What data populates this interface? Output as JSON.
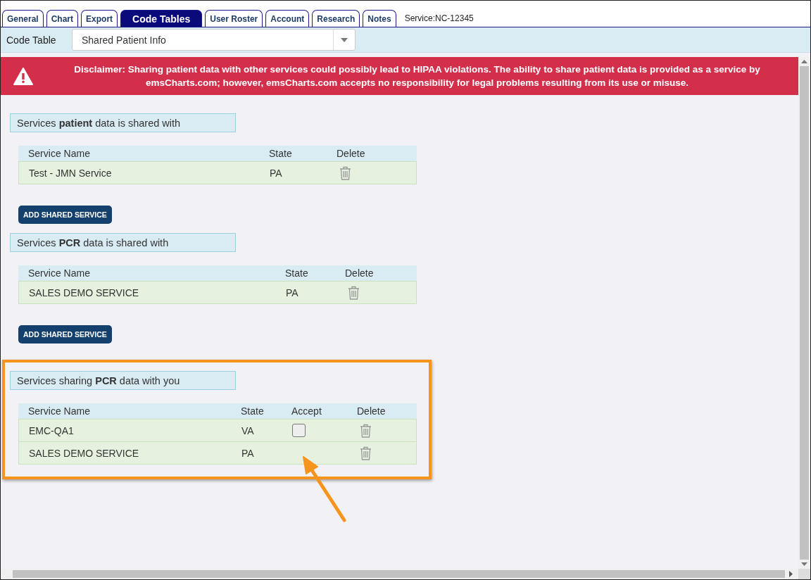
{
  "tabs": [
    {
      "label": "General",
      "selected": false
    },
    {
      "label": "Chart",
      "selected": false
    },
    {
      "label": "Export",
      "selected": false
    },
    {
      "label": "Code Tables",
      "selected": true
    },
    {
      "label": "User Roster",
      "selected": false
    },
    {
      "label": "Account",
      "selected": false
    },
    {
      "label": "Research",
      "selected": false
    },
    {
      "label": "Notes",
      "selected": false
    }
  ],
  "service_id": "Service:NC-12345",
  "code_table": {
    "label": "Code Table",
    "value": "Shared Patient Info"
  },
  "disclaimer": "Disclaimer: Sharing patient data with other services could possibly lead to HIPAA violations. The ability to share patient data is provided as a service by emsCharts.com; however, emsCharts.com accepts no responsibility for legal problems resulting from its use or misuse.",
  "sections": [
    {
      "title": "Services **patient** data is shared with",
      "highlighted": false,
      "columns": [
        "Service Name",
        "State",
        "Delete"
      ],
      "rows": [
        {
          "service_name": "Test - JMN Service",
          "state": "PA"
        }
      ],
      "button": "ADD SHARED SERVICE"
    },
    {
      "title": "Services **PCR** data is shared with",
      "highlighted": false,
      "columns": [
        "Service Name",
        "State",
        "Delete"
      ],
      "rows": [
        {
          "service_name": "SALES DEMO SERVICE",
          "state": "PA"
        }
      ],
      "button": "ADD SHARED SERVICE"
    },
    {
      "title": "Services sharing **PCR** data with you",
      "highlighted": true,
      "columns": [
        "Service Name",
        "State",
        "Accept",
        "Delete"
      ],
      "rows": [
        {
          "service_name": "EMC-QA1",
          "state": "VA",
          "accept": {
            "checked": false
          }
        },
        {
          "service_name": "SALES DEMO SERVICE",
          "state": "PA"
        }
      ]
    }
  ]
}
